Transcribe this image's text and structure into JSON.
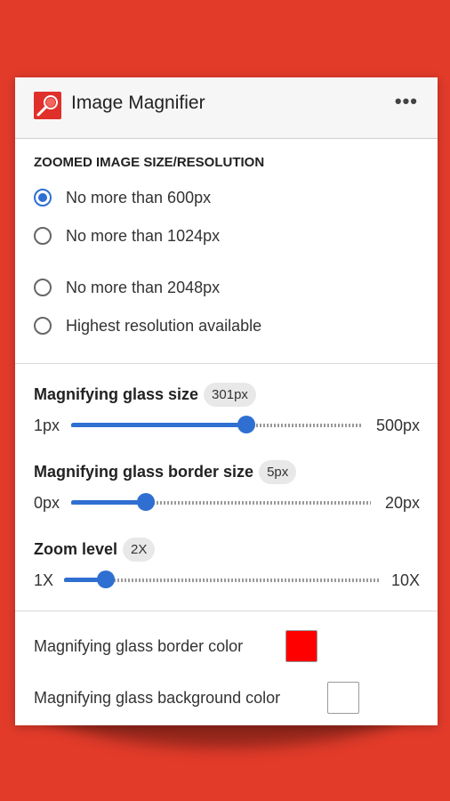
{
  "header": {
    "title": "Image Magnifier",
    "menu_icon": "more-horizontal-icon",
    "menu_glyph": "•••"
  },
  "resolution": {
    "heading": "ZOOMED IMAGE SIZE/RESOLUTION",
    "selected": 0,
    "options": [
      "No more than 600px",
      "No more than 1024px",
      "No more than 2048px",
      "Highest resolution available"
    ]
  },
  "sliders": [
    {
      "label": "Magnifying glass size",
      "value_text": "301px",
      "min_label": "1px",
      "max_label": "500px",
      "fraction": 0.603
    },
    {
      "label": "Magnifying glass border size",
      "value_text": "5px",
      "min_label": "0px",
      "max_label": "20px",
      "fraction": 0.25
    },
    {
      "label": "Zoom level",
      "value_text": "2X",
      "min_label": "1X",
      "max_label": "10X",
      "fraction": 0.133
    }
  ],
  "colors": {
    "border_label": "Magnifying glass border color",
    "border_value": "#ff0000",
    "background_label": "Magnifying glass background color",
    "background_value": "#ffffff"
  },
  "accent": "#2f6fd1"
}
